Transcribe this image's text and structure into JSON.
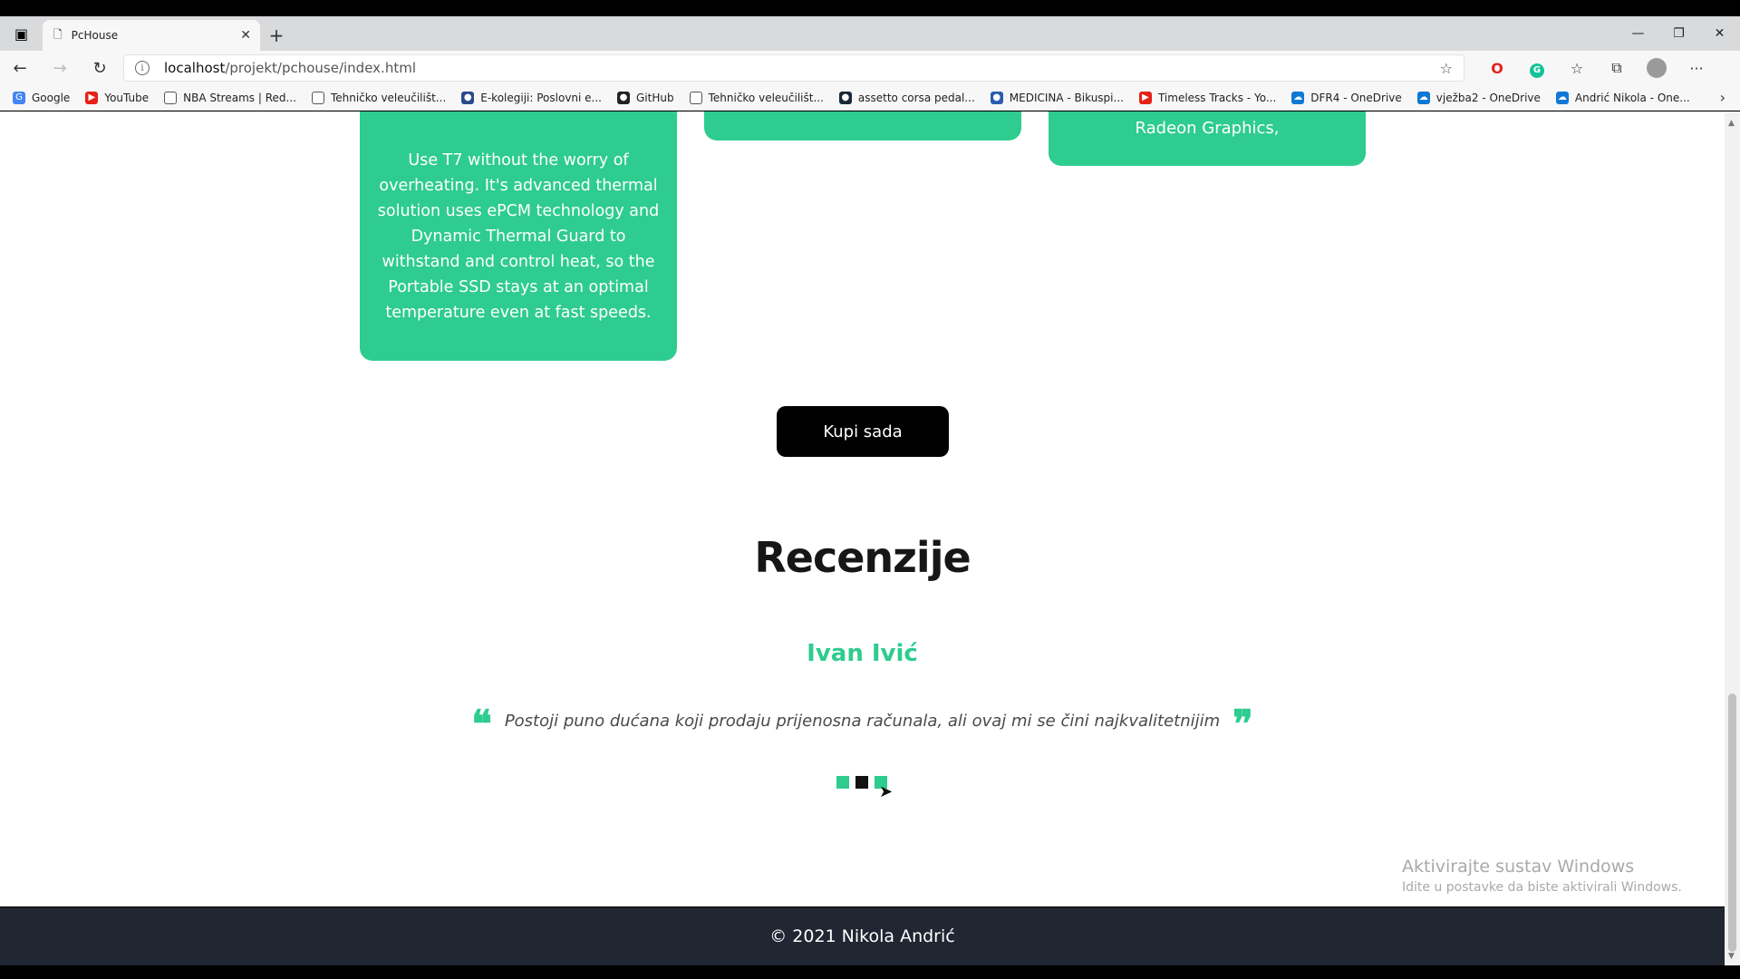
{
  "browser": {
    "tab_title": "PcHouse",
    "tab_close": "✕",
    "new_tab": "+",
    "url_host": "localhost",
    "url_path": "/projekt/pchouse/index.html",
    "window_controls": {
      "minimize": "—",
      "restore": "❐",
      "close": "✕"
    }
  },
  "bookmarks": [
    {
      "label": "Google",
      "icon": "google-icon",
      "color": "#4285f4",
      "glyph": "G"
    },
    {
      "label": "YouTube",
      "icon": "youtube-icon",
      "color": "#e62117",
      "glyph": "▶"
    },
    {
      "label": "NBA Streams | Red...",
      "icon": "page-icon",
      "color": "#ffffff",
      "glyph": ""
    },
    {
      "label": "Tehničko veleučilišt...",
      "icon": "page-icon",
      "color": "#ffffff",
      "glyph": ""
    },
    {
      "label": "E-kolegiji: Poslovni e...",
      "icon": "ekolegij-icon",
      "color": "#2b4a8b",
      "glyph": "●"
    },
    {
      "label": "GitHub",
      "icon": "github-icon",
      "color": "#222222",
      "glyph": "●"
    },
    {
      "label": "Tehničko veleučilišt...",
      "icon": "page-icon",
      "color": "#ffffff",
      "glyph": ""
    },
    {
      "label": "assetto corsa pedal...",
      "icon": "steam-icon",
      "color": "#1b2838",
      "glyph": "●"
    },
    {
      "label": "MEDICINA - Bikuspi...",
      "icon": "globe-icon",
      "color": "#2a5db0",
      "glyph": "●"
    },
    {
      "label": "Timeless Tracks - Yo...",
      "icon": "youtube-icon",
      "color": "#e62117",
      "glyph": "▶"
    },
    {
      "label": "DFR4 - OneDrive",
      "icon": "onedrive-icon",
      "color": "#0f78d4",
      "glyph": "☁"
    },
    {
      "label": "vježba2 - OneDrive",
      "icon": "onedrive-icon",
      "color": "#0f78d4",
      "glyph": "☁"
    },
    {
      "label": "Andrić Nikola - One...",
      "icon": "onedrive-icon",
      "color": "#0f78d4",
      "glyph": "☁"
    }
  ],
  "cards": {
    "card1_text": "Use T7 without the worry of overheating. It's advanced thermal solution uses ePCM technology and Dynamic Thermal Guard to withstand and control heat, so the Portable SSD stays at an optimal temperature even at fast speeds.",
    "card3_text": "Radeon Graphics,"
  },
  "buy_button": "Kupi sada",
  "reviews": {
    "title": "Recenzije",
    "reviewer": "Ivan Ivić",
    "quote_open": "❝",
    "quote_text": "Postoji puno dućana koji prodaju prijenosna računala, ali ovaj mi se čini najkvalitetnijim",
    "quote_close": "❞",
    "slider_active_index": 1
  },
  "watermark": {
    "line1": "Aktivirajte sustav Windows",
    "line2": "Idite u postavke da biste aktivirali Windows."
  },
  "footer": "© 2021 Nikola Andrić",
  "colors": {
    "accent": "#2ecc8f",
    "footer_bg": "#202632",
    "button_bg": "#000000"
  }
}
